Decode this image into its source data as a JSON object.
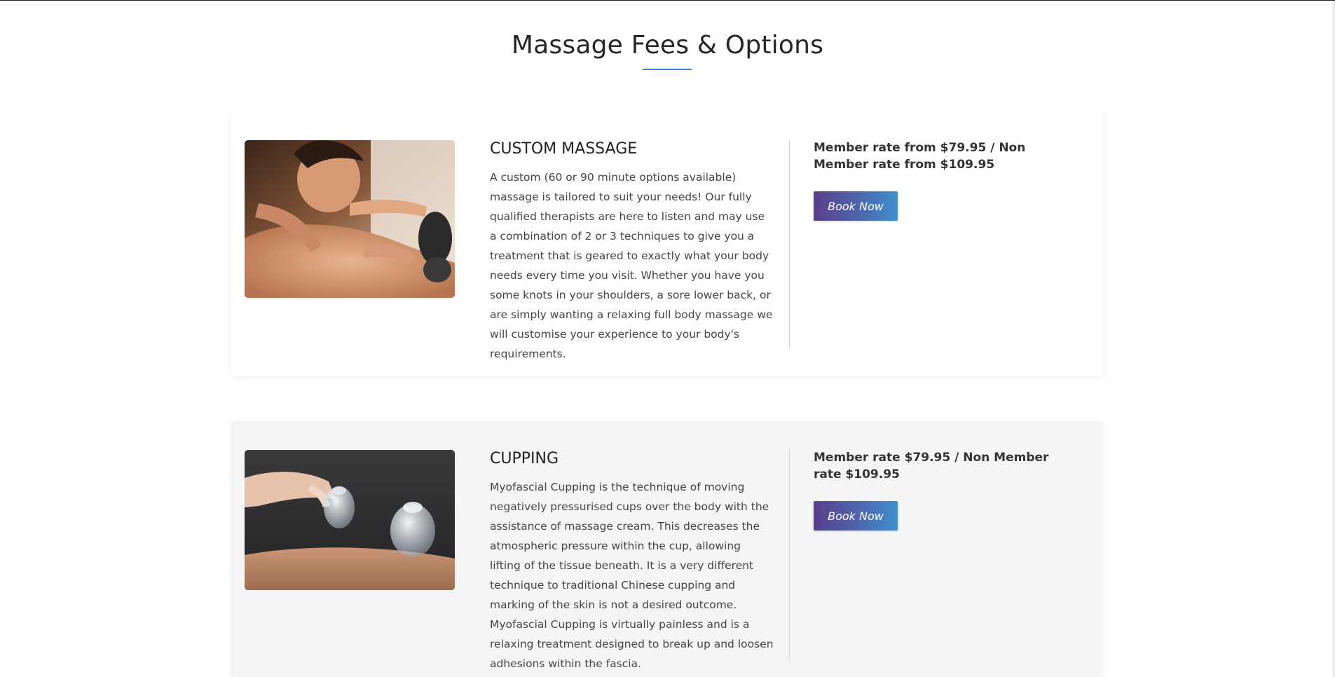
{
  "page": {
    "title": "Massage Fees & Options",
    "accent_color": "#3b82d4"
  },
  "services": [
    {
      "name": "CUSTOM MASSAGE",
      "image_icon": "massage-photo",
      "description": "A custom (60 or 90 minute options available) massage is tailored to suit your needs! Our fully qualified therapists are here to listen and may use a combination of 2 or 3 techniques to give you a treatment that is geared to exactly what your body needs every time you visit. Whether you have you some knots in your shoulders, a sore lower back, or are simply wanting a relaxing full body massage we will customise your experience to your body's requirements.",
      "rate": "Member rate from $79.95 / Non Member rate from $109.95",
      "button_label": "Book Now"
    },
    {
      "name": "CUPPING",
      "image_icon": "cupping-photo",
      "description": "Myofascial Cupping is the technique of moving negatively pressurised cups over the body with the assistance of massage cream. This decreases the atmospheric pressure within the cup, allowing lifting of the tissue beneath. It is a very different technique to traditional Chinese cupping and marking of the skin is not a desired outcome. Myofascial Cupping is virtually painless and is a relaxing treatment designed to break up and loosen adhesions within the fascia.",
      "rate": "Member rate $79.95 / Non Member rate $109.95",
      "button_label": "Book Now"
    }
  ],
  "colors": {
    "button_gradient_start": "#5b3d8a",
    "button_gradient_end": "#3f8fd0",
    "alt_card_background": "#f5f5f5"
  }
}
